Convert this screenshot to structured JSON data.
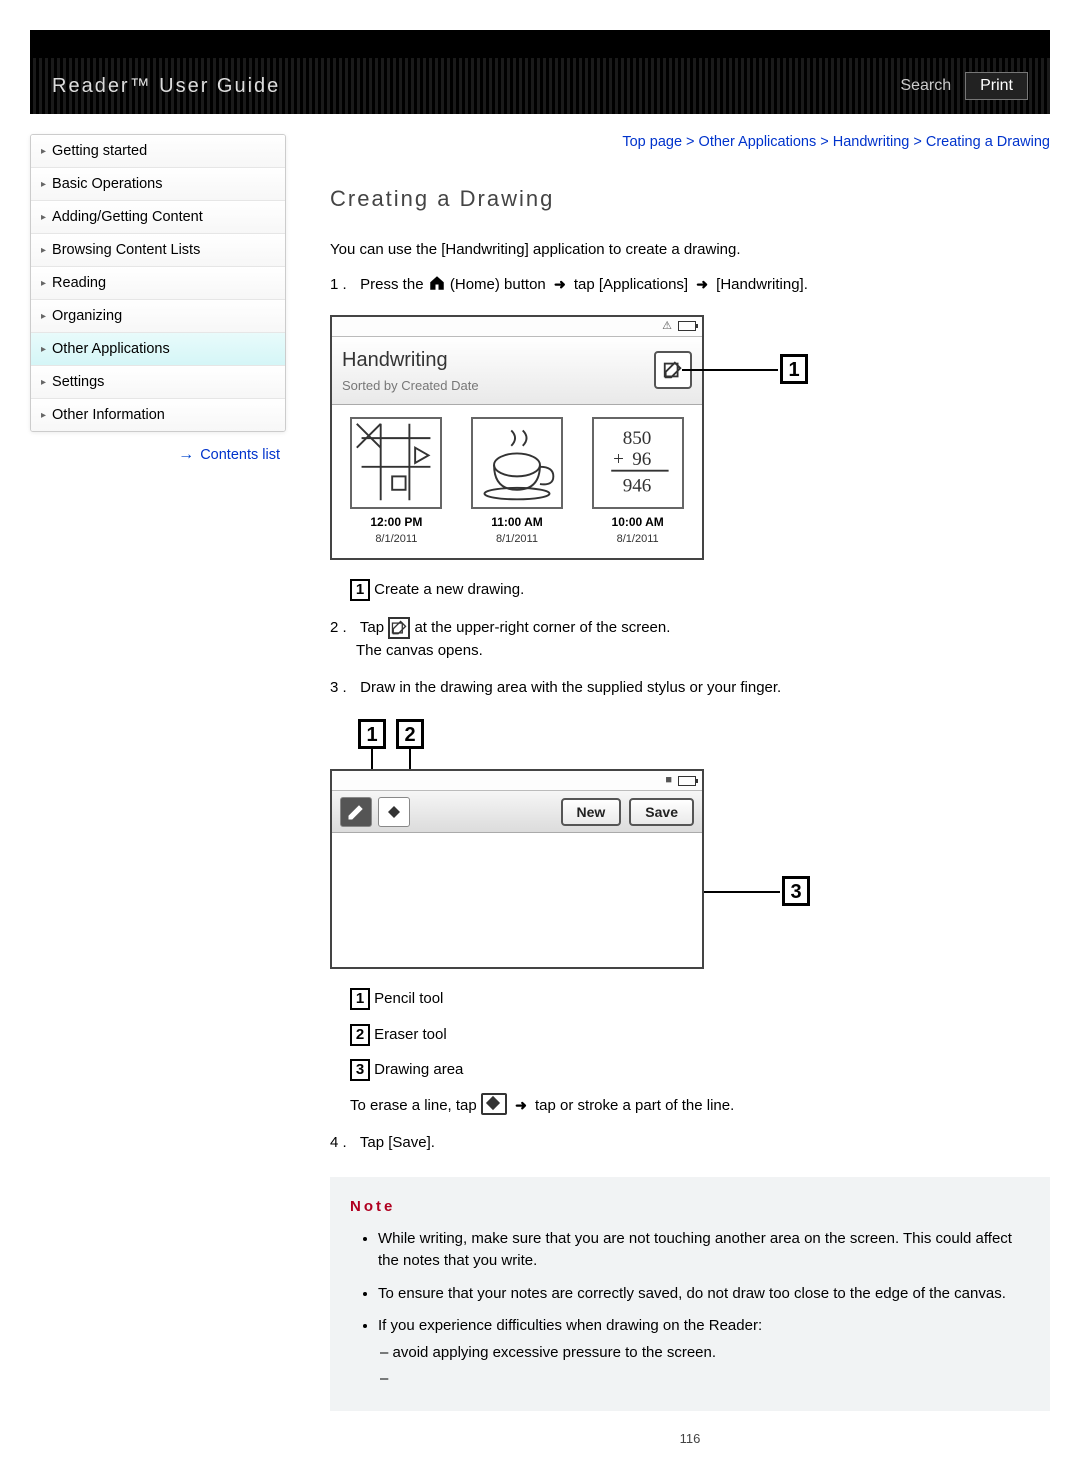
{
  "header": {
    "title": "Reader™ User Guide",
    "search_label": "Search",
    "print_label": "Print"
  },
  "breadcrumb": {
    "top": "Top page",
    "l1": "Other Applications",
    "l2": "Handwriting",
    "l3": "Creating a Drawing"
  },
  "sidebar": {
    "items": [
      {
        "label": "Getting started"
      },
      {
        "label": "Basic Operations"
      },
      {
        "label": "Adding/Getting Content"
      },
      {
        "label": "Browsing Content Lists"
      },
      {
        "label": "Reading"
      },
      {
        "label": "Organizing"
      },
      {
        "label": "Other Applications"
      },
      {
        "label": "Settings"
      },
      {
        "label": "Other Information"
      }
    ],
    "contents_list": "Contents list"
  },
  "main": {
    "title": "Creating a Drawing",
    "intro": "You can use the [Handwriting] application to create a drawing.",
    "step1_a": "Press the",
    "step1_b": "(Home) button",
    "step1_c": "tap [Applications]",
    "step1_d": "[Handwriting].",
    "step2_a": "Tap",
    "step2_b": "at the upper-right corner of the screen.",
    "step2_c": "The canvas opens.",
    "step3": "Draw in the drawing area with the supplied stylus or your finger.",
    "step4": "Tap [Save].",
    "legend1": "Create a new drawing.",
    "legend_pencil": "Pencil tool",
    "legend_eraser": "Eraser tool",
    "legend_area": "Drawing area",
    "erase_a": "To erase a line, tap",
    "erase_b": "tap or stroke a part of the line.",
    "note_title": "Note",
    "notes": [
      "While writing, make sure that you are not touching another area on the screen. This could affect the notes that you write.",
      "To ensure that your notes are correctly saved, do not draw too close to the edge of the canvas.",
      "If you experience difficulties when drawing on the Reader:"
    ],
    "note3_sub1": "avoid applying excessive pressure to the screen.",
    "page_num": "116"
  },
  "screenshot1": {
    "title": "Handwriting",
    "subtitle": "Sorted by Created Date",
    "thumbs": [
      {
        "time": "12:00 PM",
        "date": "8/1/2011"
      },
      {
        "time": "11:00 AM",
        "date": "8/1/2011"
      },
      {
        "time": "10:00 AM",
        "date": "8/1/2011",
        "sum_a": "850",
        "sum_b": "96",
        "sum_c": "946"
      }
    ]
  },
  "screenshot2": {
    "new_label": "New",
    "save_label": "Save"
  },
  "callout_nums": {
    "one": "1",
    "two": "2",
    "three": "3"
  }
}
